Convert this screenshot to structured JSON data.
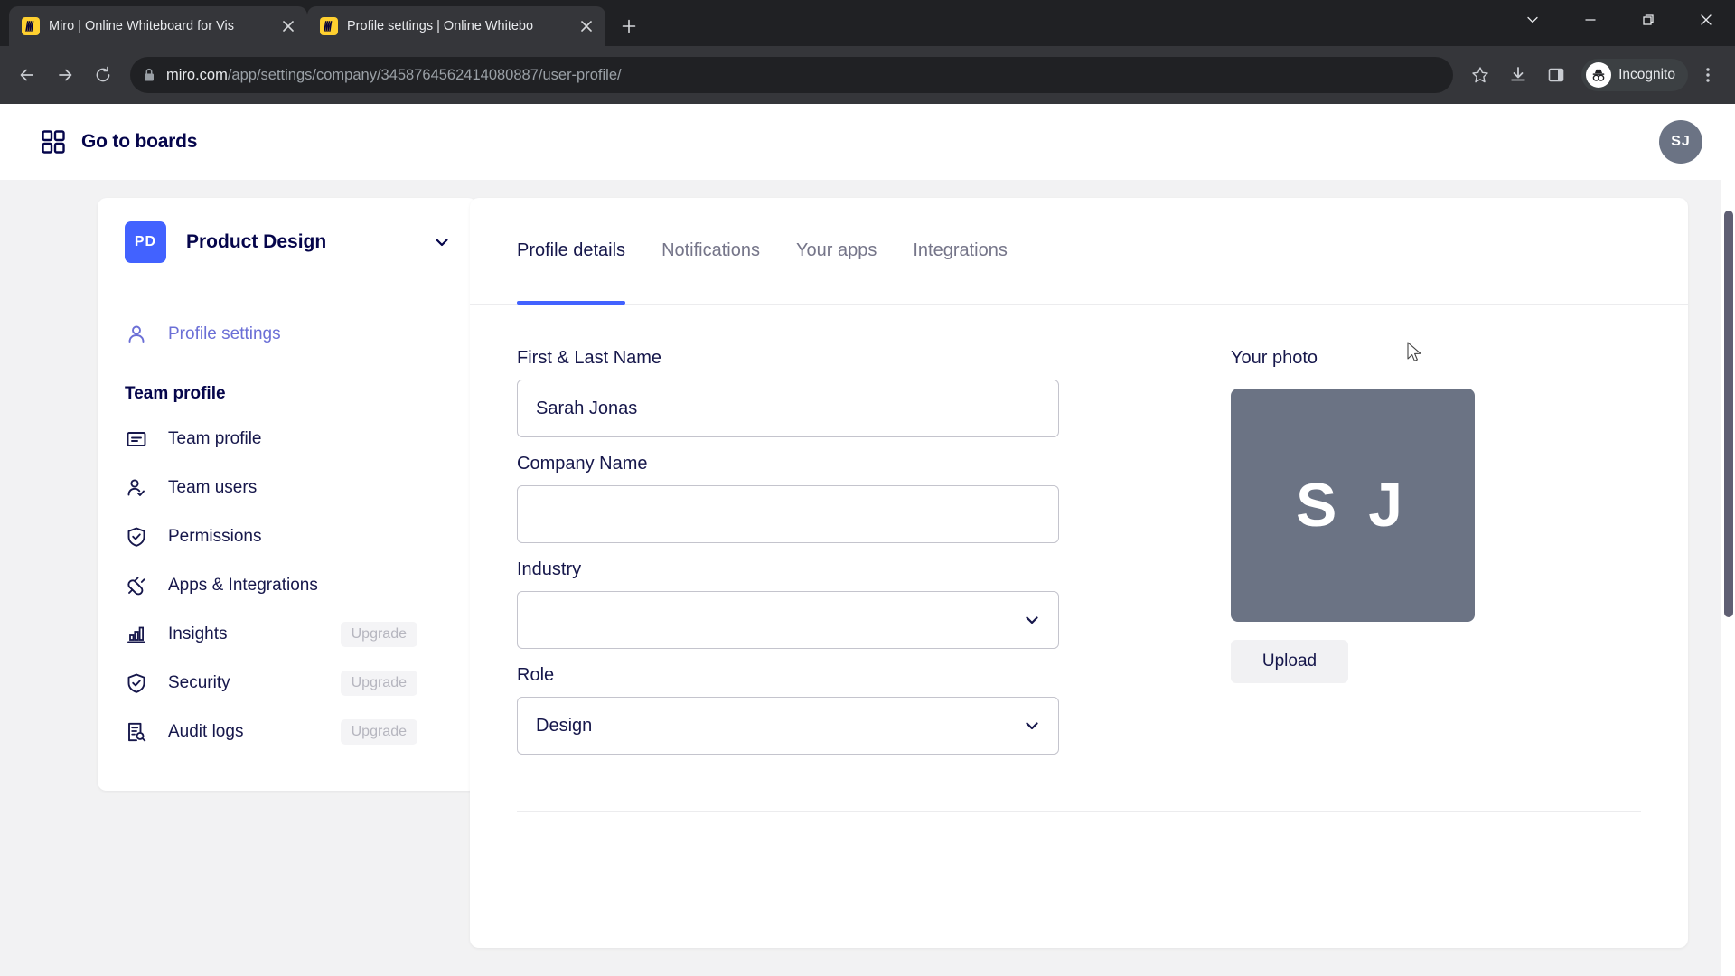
{
  "browser": {
    "tabs": [
      {
        "title": "Miro | Online Whiteboard for Vis",
        "favicon": "miro-favicon",
        "active": false
      },
      {
        "title": "Profile settings | Online Whitebo",
        "favicon": "miro-favicon",
        "active": true
      }
    ],
    "new_tab_label": "+",
    "window_controls": [
      "tab-search-chevron",
      "minimize",
      "restore",
      "close"
    ],
    "omnibox": {
      "domain": "miro.com",
      "path": "/app/settings/company/3458764562414080887/user-profile/",
      "lock_icon": "lock-icon"
    },
    "toolbar_icons": [
      "back-arrow",
      "forward-arrow",
      "reload",
      "bookmark-star",
      "download",
      "side-panel",
      "menu-dots"
    ],
    "profile_pill": "Incognito"
  },
  "header": {
    "go_to_boards": "Go to boards",
    "grid_icon": "grid-icon",
    "avatar_initials": "SJ"
  },
  "sidebar": {
    "team": {
      "badge": "PD",
      "name": "Product Design",
      "chevron_icon": "chevron-down-icon",
      "badge_color": "#4262ff"
    },
    "top_items": [
      {
        "label": "Profile settings",
        "icon": "person-icon",
        "active": true
      }
    ],
    "section_title": "Team profile",
    "items": [
      {
        "label": "Team profile",
        "icon": "id-card-icon",
        "badge": ""
      },
      {
        "label": "Team users",
        "icon": "person-check-icon",
        "badge": ""
      },
      {
        "label": "Permissions",
        "icon": "shield-check-icon",
        "badge": ""
      },
      {
        "label": "Apps & Integrations",
        "icon": "plug-icon",
        "badge": ""
      },
      {
        "label": "Insights",
        "icon": "bar-chart-icon",
        "badge": "Upgrade"
      },
      {
        "label": "Security",
        "icon": "shield-check-icon",
        "badge": "Upgrade"
      },
      {
        "label": "Audit logs",
        "icon": "document-search-icon",
        "badge": "Upgrade"
      }
    ]
  },
  "main": {
    "tabs": [
      {
        "label": "Profile details",
        "active": true
      },
      {
        "label": "Notifications",
        "active": false
      },
      {
        "label": "Your apps",
        "active": false
      },
      {
        "label": "Integrations",
        "active": false
      }
    ],
    "accent_color": "#4262ff",
    "fields": {
      "name": {
        "label": "First & Last Name",
        "value": "Sarah Jonas",
        "placeholder": ""
      },
      "company": {
        "label": "Company Name",
        "value": "",
        "placeholder": ""
      },
      "industry": {
        "label": "Industry",
        "value": "",
        "placeholder": "",
        "chevron_icon": "chevron-down-icon"
      },
      "role": {
        "label": "Role",
        "value": "Design",
        "placeholder": "",
        "chevron_icon": "chevron-down-icon"
      }
    },
    "photo": {
      "title": "Your photo",
      "initials": "S J",
      "upload_label": "Upload",
      "avatar_color": "#6b7384"
    }
  }
}
